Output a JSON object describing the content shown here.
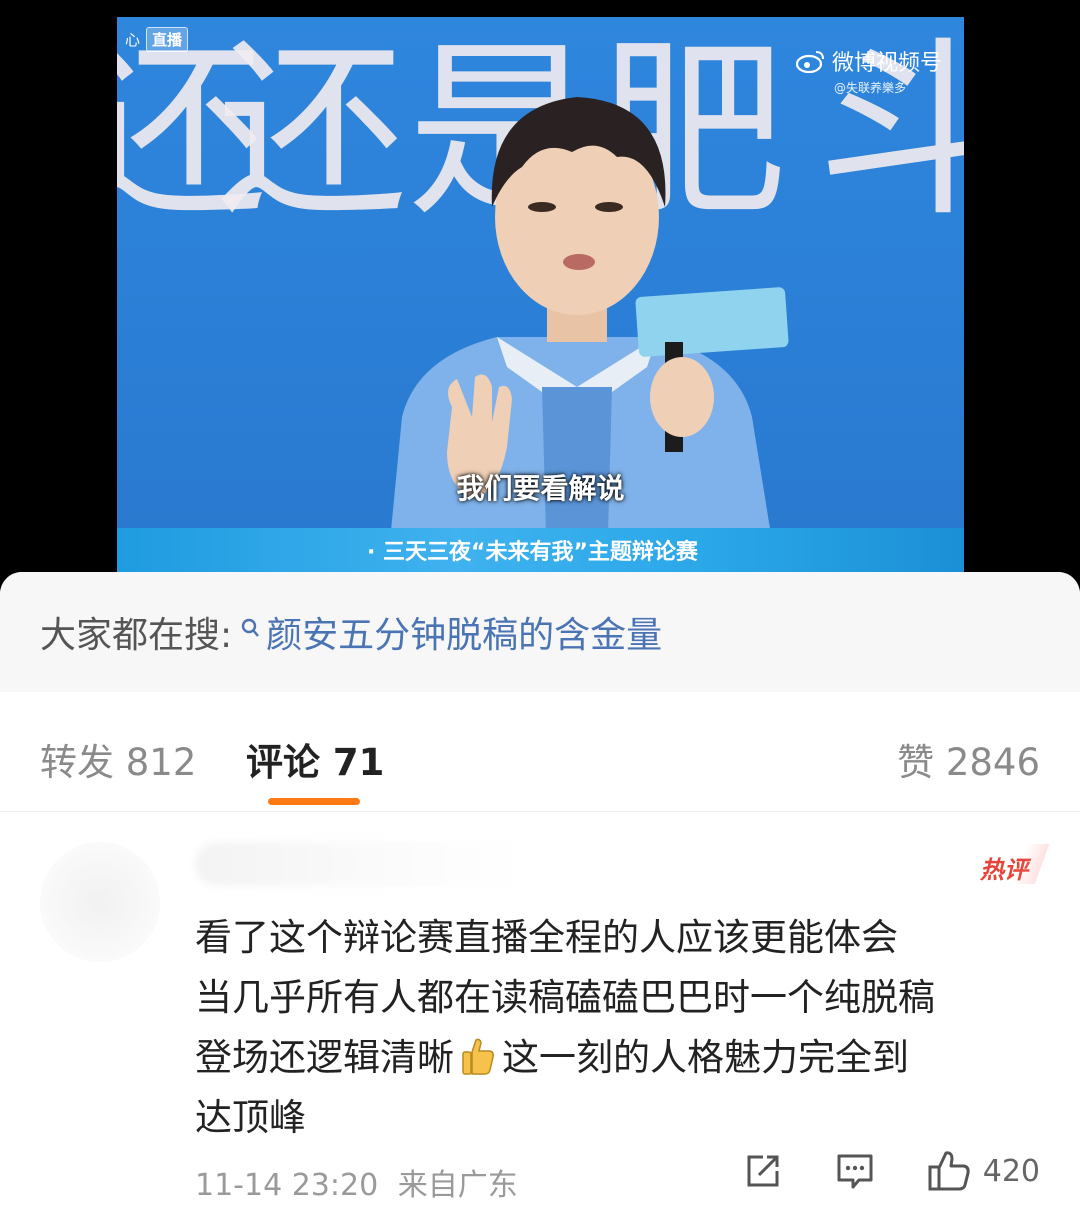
{
  "video": {
    "live_tag": "直播",
    "live_prefix": "心",
    "background_chars": [
      "还",
      "是",
      "肥",
      "斗"
    ],
    "watermark_brand": "微博视频号",
    "watermark_handle": "@失联养樂多",
    "subtitle": "我们要看解说",
    "ticker": "· 三天三夜“未来有我”主题辩论赛"
  },
  "search": {
    "label": "大家都在搜:",
    "query": "颜安五分钟脱稿的含金量"
  },
  "tabs": {
    "repost": "转发 812",
    "comments": "评论 71",
    "likes": "赞 2846"
  },
  "comment": {
    "hot_badge": "热评",
    "lines": [
      "看了这个辩论赛直播全程的人应该更能体会",
      "当几乎所有人都在读稿磕磕巴巴时一个纯脱稿",
      "登场还逻辑清晰",
      "这一刻的人格魅力完全到",
      "达顶峰"
    ],
    "timestamp": "11-14 23:20",
    "location": "来自广东",
    "like_count": "420"
  },
  "colors": {
    "accent": "#ff7a14",
    "link": "#4b74b5",
    "hot": "#e6433a",
    "video_bg": "#2b7fd6"
  },
  "icons": [
    "search-icon",
    "share-icon",
    "comment-icon",
    "like-icon",
    "thumbs-up-emoji",
    "weibo-logo-icon"
  ]
}
